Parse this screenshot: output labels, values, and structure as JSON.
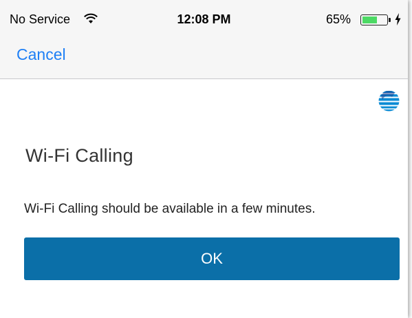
{
  "status_bar": {
    "carrier": "No Service",
    "time": "12:08 PM",
    "battery_percent": "65%",
    "battery_level": 0.65,
    "battery_color": "#4cd964",
    "icons": [
      "wifi-icon",
      "battery-icon",
      "charging-bolt-icon"
    ]
  },
  "nav": {
    "cancel_label": "Cancel",
    "accent_color": "#1e7ff5"
  },
  "content": {
    "logo": "att-globe-logo",
    "title": "Wi-Fi Calling",
    "message": "Wi-Fi Calling should be available in a few minutes.",
    "ok_label": "OK",
    "button_color": "#0b6fa8"
  }
}
